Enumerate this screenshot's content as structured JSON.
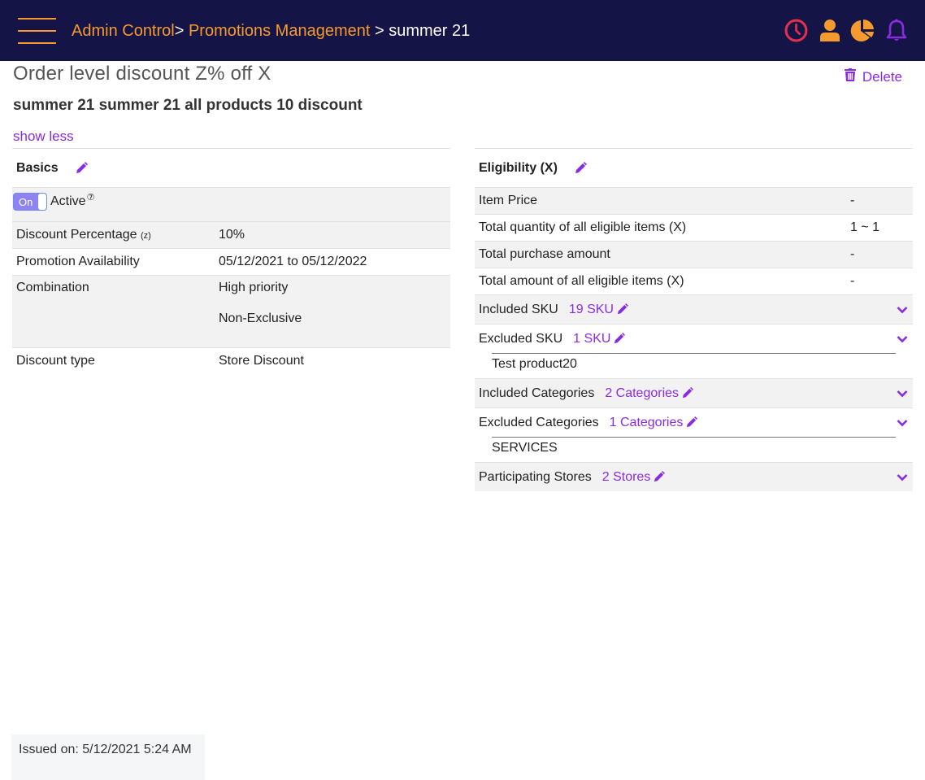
{
  "header": {
    "menu_icon": "hamburger-icon",
    "breadcrumb": {
      "items": [
        "Admin Control",
        "Promotions Management"
      ],
      "separator": ">",
      "current": "summer 21"
    },
    "icons": [
      {
        "name": "clock-icon",
        "color": "#e0314b"
      },
      {
        "name": "user-icon",
        "color": "#f59a2f"
      },
      {
        "name": "pie-chart-icon",
        "color": "#f59a2f"
      },
      {
        "name": "bell-icon",
        "color": "#8a2be2"
      }
    ]
  },
  "page": {
    "title": "Order level discount Z% off X",
    "subtitle": "summer 21 summer 21 all products 10 discount",
    "show_less": "show less",
    "delete_label": "Delete"
  },
  "basics": {
    "title": "Basics",
    "toggle": {
      "label": "On",
      "state": "on"
    },
    "active_label": "Active",
    "help_glyph": "⑦",
    "rows": [
      {
        "label": "Discount Percentage",
        "label_suffix": "(z)",
        "value": "10%"
      },
      {
        "label": "Promotion Availability",
        "value": "05/12/2021 to 05/12/2022"
      },
      {
        "label": "Combination",
        "value": "High priority",
        "value2": "Non-Exclusive"
      },
      {
        "label": "Discount type",
        "value": "Store Discount"
      }
    ]
  },
  "eligibility": {
    "title": "Eligibility (X)",
    "rows": [
      {
        "label": "Item Price",
        "value": "-"
      },
      {
        "label": "Total quantity of all eligible items (X)",
        "value": "1 ~ 1"
      },
      {
        "label": "Total purchase amount",
        "value": "-"
      },
      {
        "label": "Total amount of all eligible items (X)",
        "value": "-"
      }
    ],
    "sections": [
      {
        "label": "Included SKU",
        "count": "19 SKU",
        "items": []
      },
      {
        "label": "Excluded SKU",
        "count": "1 SKU",
        "items": [
          "Test product20"
        ]
      },
      {
        "label": "Included Categories",
        "count": "2 Categories",
        "items": []
      },
      {
        "label": "Excluded Categories",
        "count": "1 Categories",
        "items": [
          "SERVICES"
        ]
      },
      {
        "label": "Participating Stores",
        "count": "2 Stores",
        "items": []
      }
    ]
  },
  "footer": {
    "issued": "Issued on: 5/12/2021 5:24 AM"
  },
  "colors": {
    "header_bg": "#151447",
    "accent_orange": "#f59a2f",
    "accent_purple": "#8a2be2",
    "alert_red": "#e0314b"
  }
}
